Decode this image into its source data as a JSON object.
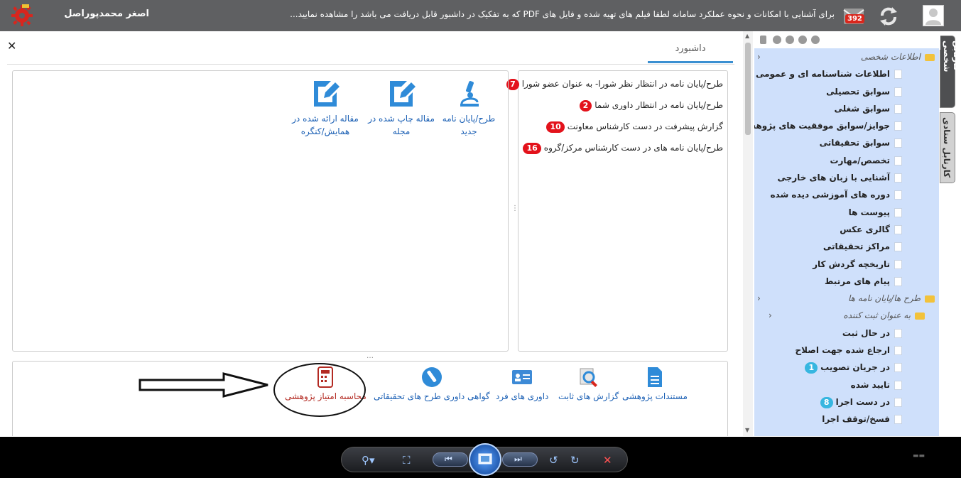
{
  "topbar": {
    "username": "اصغر محمدپوراصل",
    "notice": "برای آشنایی با امکانات و نحوه عملکرد سامانه لطفا فیلم های تهیه شده و فایل های PDF که به تفکیک در داشبور قابل دریافت می باشد را مشاهده نمایید...",
    "message_count": "392"
  },
  "vtabs": {
    "personal": "کارتابل شخصی",
    "staff": "کارتابل ستادی"
  },
  "tree": {
    "personal_info_folder": "اطلاعات شخصی",
    "personal_items": [
      "اطلاعات شناسنامه ای و عمومی",
      "سوابق تحصیلی",
      "سوابق شغلی",
      "جوایز/سوابق موفقیت های پژوهشی",
      "سوابق تحقیقاتی",
      "تخصص/مهارت",
      "آشنایی با زبان های خارجی",
      "دوره های آموزشی دیده شده",
      "پیوست ها",
      "گالری عکس",
      "مراکز تحقیقاتی",
      "تاریخچه گردش کار",
      "پیام های مرتبط"
    ],
    "projects_folder": "طرح ها/پایان نامه ها",
    "registrant_folder": "به عنوان ثبت کننده",
    "registrant_items": [
      {
        "label": "در حال ثبت",
        "badge": ""
      },
      {
        "label": "ارجاع شده جهت اصلاح",
        "badge": ""
      },
      {
        "label": "در جریان تصویب",
        "badge": "1"
      },
      {
        "label": "تایید شده",
        "badge": ""
      },
      {
        "label": "در دست اجرا",
        "badge": "8"
      },
      {
        "label": "فسخ/توقف اجرا",
        "badge": ""
      }
    ]
  },
  "main": {
    "dashboard_tab": "داشبورد",
    "alerts": [
      {
        "label": "طرح/پایان نامه در انتظار نظر شورا- به عنوان عضو شورا",
        "count": "7"
      },
      {
        "label": "طرح/پایان نامه در انتظار داوری شما",
        "count": "2"
      },
      {
        "label": "گزارش پیشرفت در دست کارشناس معاونت",
        "count": "10"
      },
      {
        "label": "طرح/پایان نامه های در دست کارشناس مرکز/گروه",
        "count": "16"
      }
    ],
    "quick_links": {
      "new_thesis_line1": "طرح/پایان نامه",
      "new_thesis_line2": "جدید",
      "journal_line1": "مقاله چاپ شده در",
      "journal_line2": "مجله",
      "conference_line1": "مقاله ارائه شده در",
      "conference_line2": "همایش/کنگره"
    },
    "bottom_links": {
      "research_docs": "مستندات پژوهشی",
      "fixed_reports": "گزارش های ثابت",
      "individual_reviews": "داوری های فرد",
      "review_certificate": "گواهی داوری طرح های تحقیقاتی",
      "research_score": "محاسبه امتیاز پژوهشی"
    }
  },
  "colors": {
    "topbar": "#5f6062",
    "tree_bg": "#cfe0fb",
    "link": "#1a5fb4",
    "badge_red": "#e3121b",
    "badge_blue": "#36b6e0",
    "accent": "#3a8fd1"
  }
}
